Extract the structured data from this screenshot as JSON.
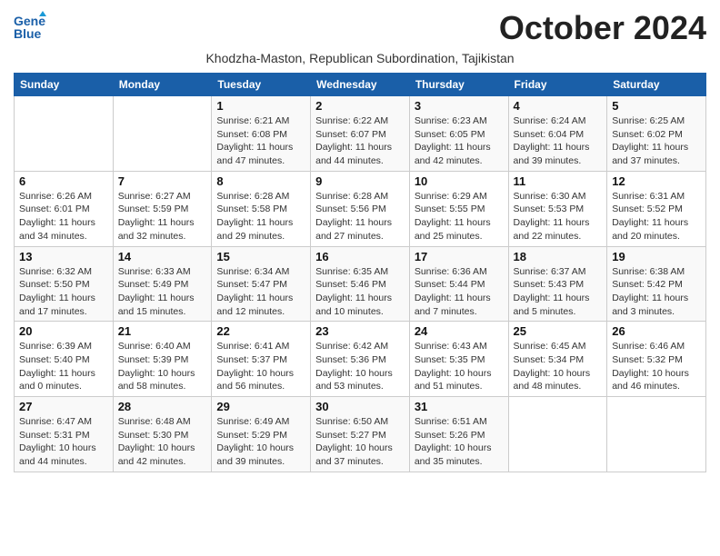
{
  "header": {
    "title": "October 2024",
    "subtitle": "Khodzha-Maston, Republican Subordination, Tajikistan",
    "logo_line1": "General",
    "logo_line2": "Blue"
  },
  "days_of_week": [
    "Sunday",
    "Monday",
    "Tuesday",
    "Wednesday",
    "Thursday",
    "Friday",
    "Saturday"
  ],
  "weeks": [
    [
      {
        "day": "",
        "info": ""
      },
      {
        "day": "",
        "info": ""
      },
      {
        "day": "1",
        "info": "Sunrise: 6:21 AM\nSunset: 6:08 PM\nDaylight: 11 hours and 47 minutes."
      },
      {
        "day": "2",
        "info": "Sunrise: 6:22 AM\nSunset: 6:07 PM\nDaylight: 11 hours and 44 minutes."
      },
      {
        "day": "3",
        "info": "Sunrise: 6:23 AM\nSunset: 6:05 PM\nDaylight: 11 hours and 42 minutes."
      },
      {
        "day": "4",
        "info": "Sunrise: 6:24 AM\nSunset: 6:04 PM\nDaylight: 11 hours and 39 minutes."
      },
      {
        "day": "5",
        "info": "Sunrise: 6:25 AM\nSunset: 6:02 PM\nDaylight: 11 hours and 37 minutes."
      }
    ],
    [
      {
        "day": "6",
        "info": "Sunrise: 6:26 AM\nSunset: 6:01 PM\nDaylight: 11 hours and 34 minutes."
      },
      {
        "day": "7",
        "info": "Sunrise: 6:27 AM\nSunset: 5:59 PM\nDaylight: 11 hours and 32 minutes."
      },
      {
        "day": "8",
        "info": "Sunrise: 6:28 AM\nSunset: 5:58 PM\nDaylight: 11 hours and 29 minutes."
      },
      {
        "day": "9",
        "info": "Sunrise: 6:28 AM\nSunset: 5:56 PM\nDaylight: 11 hours and 27 minutes."
      },
      {
        "day": "10",
        "info": "Sunrise: 6:29 AM\nSunset: 5:55 PM\nDaylight: 11 hours and 25 minutes."
      },
      {
        "day": "11",
        "info": "Sunrise: 6:30 AM\nSunset: 5:53 PM\nDaylight: 11 hours and 22 minutes."
      },
      {
        "day": "12",
        "info": "Sunrise: 6:31 AM\nSunset: 5:52 PM\nDaylight: 11 hours and 20 minutes."
      }
    ],
    [
      {
        "day": "13",
        "info": "Sunrise: 6:32 AM\nSunset: 5:50 PM\nDaylight: 11 hours and 17 minutes."
      },
      {
        "day": "14",
        "info": "Sunrise: 6:33 AM\nSunset: 5:49 PM\nDaylight: 11 hours and 15 minutes."
      },
      {
        "day": "15",
        "info": "Sunrise: 6:34 AM\nSunset: 5:47 PM\nDaylight: 11 hours and 12 minutes."
      },
      {
        "day": "16",
        "info": "Sunrise: 6:35 AM\nSunset: 5:46 PM\nDaylight: 11 hours and 10 minutes."
      },
      {
        "day": "17",
        "info": "Sunrise: 6:36 AM\nSunset: 5:44 PM\nDaylight: 11 hours and 7 minutes."
      },
      {
        "day": "18",
        "info": "Sunrise: 6:37 AM\nSunset: 5:43 PM\nDaylight: 11 hours and 5 minutes."
      },
      {
        "day": "19",
        "info": "Sunrise: 6:38 AM\nSunset: 5:42 PM\nDaylight: 11 hours and 3 minutes."
      }
    ],
    [
      {
        "day": "20",
        "info": "Sunrise: 6:39 AM\nSunset: 5:40 PM\nDaylight: 11 hours and 0 minutes."
      },
      {
        "day": "21",
        "info": "Sunrise: 6:40 AM\nSunset: 5:39 PM\nDaylight: 10 hours and 58 minutes."
      },
      {
        "day": "22",
        "info": "Sunrise: 6:41 AM\nSunset: 5:37 PM\nDaylight: 10 hours and 56 minutes."
      },
      {
        "day": "23",
        "info": "Sunrise: 6:42 AM\nSunset: 5:36 PM\nDaylight: 10 hours and 53 minutes."
      },
      {
        "day": "24",
        "info": "Sunrise: 6:43 AM\nSunset: 5:35 PM\nDaylight: 10 hours and 51 minutes."
      },
      {
        "day": "25",
        "info": "Sunrise: 6:45 AM\nSunset: 5:34 PM\nDaylight: 10 hours and 48 minutes."
      },
      {
        "day": "26",
        "info": "Sunrise: 6:46 AM\nSunset: 5:32 PM\nDaylight: 10 hours and 46 minutes."
      }
    ],
    [
      {
        "day": "27",
        "info": "Sunrise: 6:47 AM\nSunset: 5:31 PM\nDaylight: 10 hours and 44 minutes."
      },
      {
        "day": "28",
        "info": "Sunrise: 6:48 AM\nSunset: 5:30 PM\nDaylight: 10 hours and 42 minutes."
      },
      {
        "day": "29",
        "info": "Sunrise: 6:49 AM\nSunset: 5:29 PM\nDaylight: 10 hours and 39 minutes."
      },
      {
        "day": "30",
        "info": "Sunrise: 6:50 AM\nSunset: 5:27 PM\nDaylight: 10 hours and 37 minutes."
      },
      {
        "day": "31",
        "info": "Sunrise: 6:51 AM\nSunset: 5:26 PM\nDaylight: 10 hours and 35 minutes."
      },
      {
        "day": "",
        "info": ""
      },
      {
        "day": "",
        "info": ""
      }
    ]
  ]
}
